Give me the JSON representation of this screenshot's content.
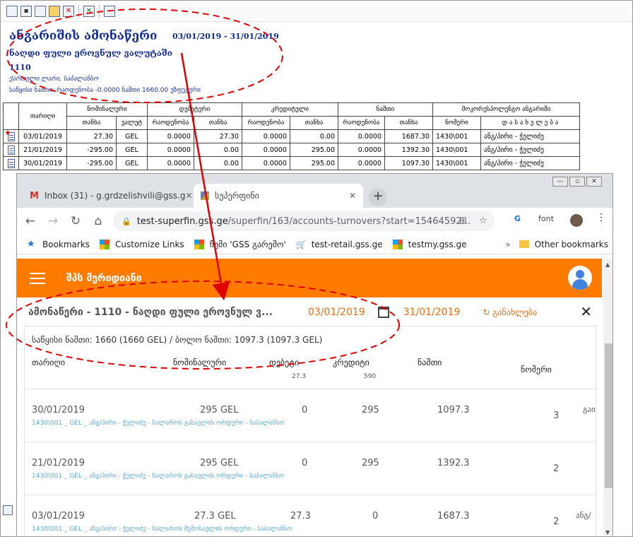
{
  "legacy": {
    "title": "ანგარიშის ამონაწერი",
    "period": "03/01/2019 - 31/01/2019",
    "subtitle": "ნაღდი ფული ეროვნულ ვალუტაში",
    "code": "1110",
    "currency_line": "ქართული ლარი,  საბალანსო",
    "balance_line": "საწყისი ნაშთი:    რაოდენობა -0.0000  ნაშთი 1660.00  ეზფეგური",
    "groups": [
      "თარიღი",
      "ნომინალური",
      "დებეტური",
      "კრედიტული",
      "ნაშთი",
      "მოკორესპოლენგო ანგარიში"
    ],
    "subheads": [
      "თანხა",
      "ვალუტ",
      "რაოდენობა",
      "თანხა",
      "რაოდენობა",
      "თანხა",
      "რაოდენობა",
      "თანხა",
      "ნომერი",
      "დ ა ს ა ხ ე ლ ე ბ ა"
    ],
    "rows": [
      {
        "date": "03/01/2019",
        "nom": "27.30",
        "cur": "GEL",
        "dq": "0.0000",
        "da": "27.30",
        "cq": "0.0000",
        "ca": "0.00",
        "bq": "0.0000",
        "ba": "1687.30",
        "acc": "1430\\001",
        "name": "ანგ/პირი - ჭელიძე"
      },
      {
        "date": "21/01/2019",
        "nom": "-295.00",
        "cur": "GEL",
        "dq": "0.0000",
        "da": "0.00",
        "cq": "0.0000",
        "ca": "295.00",
        "bq": "0.0000",
        "ba": "1392.30",
        "acc": "1430\\001",
        "name": "ანგ/პირი - ჭელიძე"
      },
      {
        "date": "30/01/2019",
        "nom": "-295.00",
        "cur": "GEL",
        "dq": "0.0000",
        "da": "0.00",
        "cq": "0.0000",
        "ca": "295.00",
        "bq": "0.0000",
        "ba": "1097.30",
        "acc": "1430\\001",
        "name": "ანგ/პირი - ჭელიძე"
      }
    ]
  },
  "browser": {
    "tabs": [
      {
        "label": "Inbox (31) - g.grdzelishvili@gss.g",
        "icon": "gmail-icon"
      },
      {
        "label": "სუპერფინი",
        "icon": "superfin-icon"
      }
    ],
    "url_host": "test-superfin.gss.ge",
    "url_path": "/superfin/163/accounts-turnovers?start=15464592...",
    "bookmarks": [
      {
        "label": "Bookmarks",
        "icon": "star-icon"
      },
      {
        "label": "Customize Links",
        "icon": "windows-icon"
      },
      {
        "label": "ჩემი 'GSS გარემო'",
        "icon": "windows-icon"
      },
      {
        "label": "test-retail.gss.ge",
        "icon": "cart-icon"
      },
      {
        "label": "testmy.gss.ge",
        "icon": "windows-icon"
      }
    ],
    "other_bookmarks": "Other bookmarks",
    "ext_font": "font"
  },
  "app": {
    "company": "შპს მერიდიანი",
    "statement_title": "ამონაწერი - 1110 - ნაღდი ფული ეროვნულ ვ...",
    "date_from": "03/01/2019",
    "date_to": "31/01/2019",
    "refresh_label": "განახლება",
    "balance_line": "საწყისი ნაშთი: 1660 (1660 GEL)  /  ბოლო ნაშთი: 1097.3 (1097.3 GEL)",
    "columns": {
      "date": "თარიღი",
      "nominal": "ნომინალური",
      "debit": "დებეტი",
      "debit_total": "27.3",
      "credit": "კრედიტი",
      "credit_total": "590",
      "balance": "ნაშთი",
      "number": "ნომერი"
    },
    "rows": [
      {
        "date": "30/01/2019",
        "nominal": "295 GEL",
        "debit": "0",
        "credit": "295",
        "balance": "1097.3",
        "number": "3",
        "extra": "გაი",
        "desc": "1430\\001 _ GEL _ ანგ/პირი - ჭელიძე - სალაროს გასავლის ორდერი - საბალანსო"
      },
      {
        "date": "21/01/2019",
        "nominal": "295 GEL",
        "debit": "0",
        "credit": "295",
        "balance": "1392.3",
        "number": "2",
        "extra": "",
        "desc": "1430\\001 _ GEL _ ანგ/პირი - ჭელიძე - სალაროს გასავლის ორდერი - საბალანსო"
      },
      {
        "date": "03/01/2019",
        "nominal": "27.3 GEL",
        "debit": "27.3",
        "credit": "0",
        "balance": "1687.3",
        "number": "2",
        "extra": "ანგ/",
        "desc": "1430\\001 _ GEL _ ანგ/პირი - ჭელიძე - სალაროს შემოსავლის ორდერი - საბალანსო"
      }
    ]
  },
  "colors": {
    "accent": "#ff7b00",
    "annotation": "#e00000",
    "legacy_text": "#102a9c",
    "link": "#5aa9e6"
  }
}
